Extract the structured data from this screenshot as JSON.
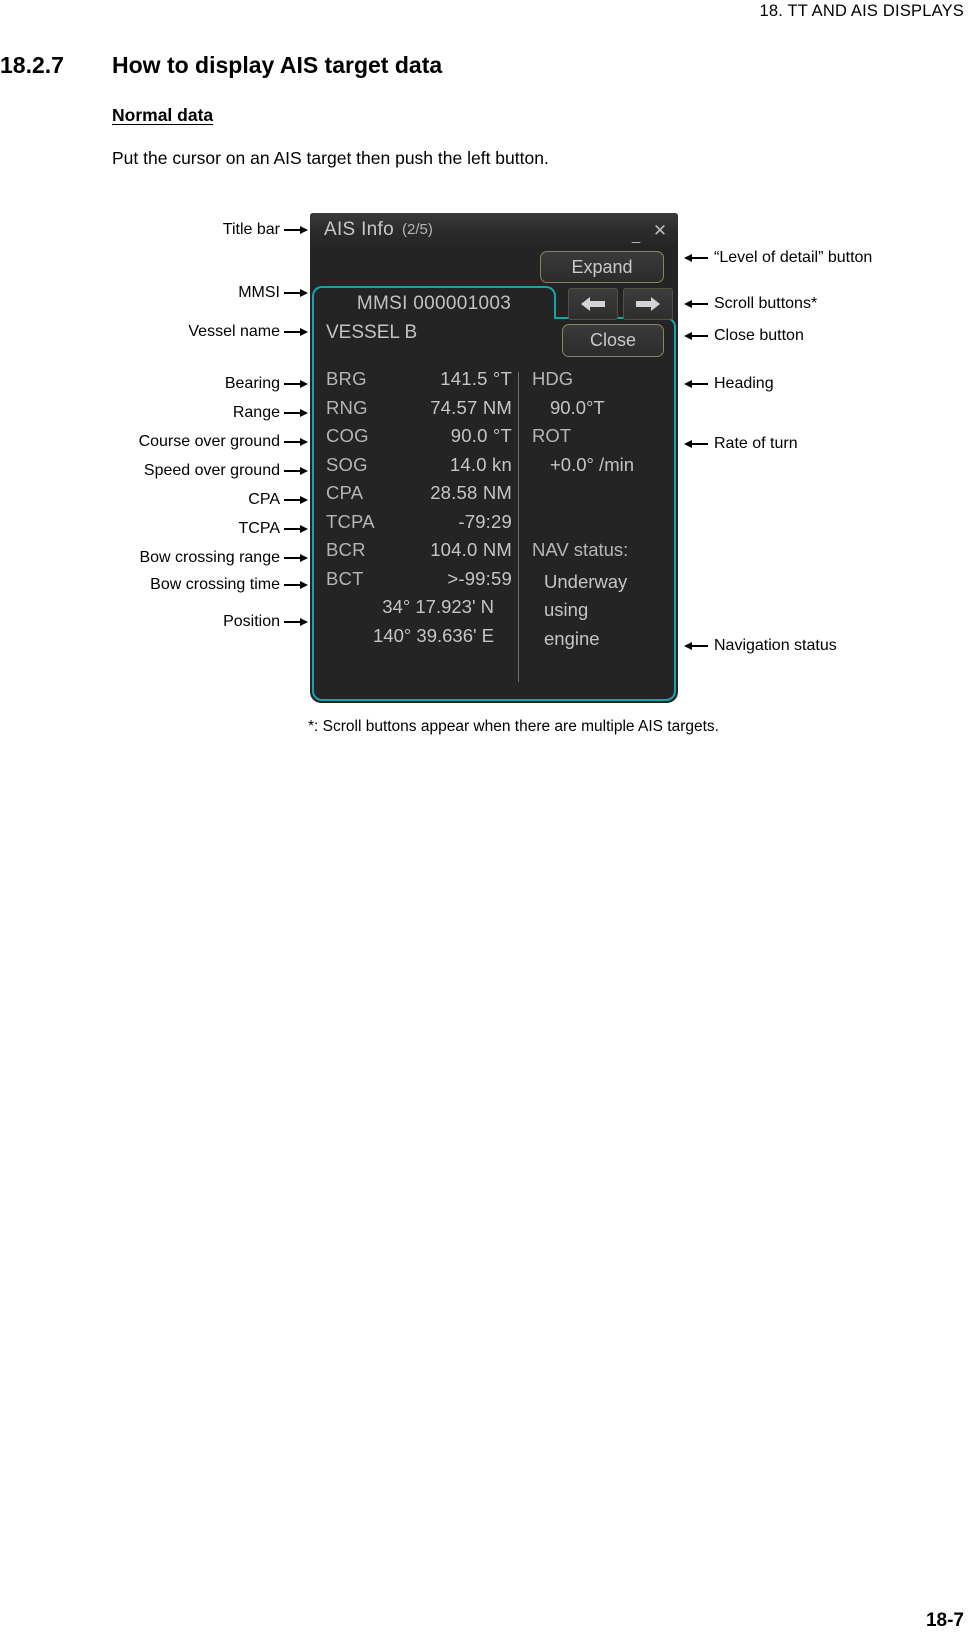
{
  "page": {
    "header": "18.  TT AND AIS DISPLAYS",
    "section_number": "18.2.7",
    "section_title": "How to display AIS target data",
    "subheading": "Normal data",
    "intro": "Put the cursor on an AIS target then push the left button.",
    "footnote": "*: Scroll buttons appear when there are multiple AIS targets.",
    "page_number": "18-7"
  },
  "panel": {
    "title": "AIS Info",
    "page_count": "(2/5)",
    "minimize_icon": "_",
    "close_icon": "✕",
    "expand_label": "Expand",
    "close_label": "Close",
    "mmsi_label": "MMSI 000001003",
    "vessel_name": "VESSEL B",
    "scroll_prev_icon": "arrow-left-icon",
    "scroll_next_icon": "arrow-right-icon",
    "left_rows": [
      {
        "key": "BRG",
        "value": "141.5 °T"
      },
      {
        "key": "RNG",
        "value": "74.57 NM"
      },
      {
        "key": "COG",
        "value": "90.0 °T"
      },
      {
        "key": "SOG",
        "value": "14.0 kn"
      },
      {
        "key": "CPA",
        "value": "28.58 NM"
      },
      {
        "key": "TCPA",
        "value": "-79:29"
      },
      {
        "key": "BCR",
        "value": "104.0 NM"
      },
      {
        "key": "BCT",
        "value": ">-99:59"
      }
    ],
    "position": {
      "latitude": "34° 17.923'  N",
      "longitude": "140° 39.636'  E"
    },
    "right_rows": [
      {
        "key": "HDG",
        "value": "90.0°T"
      },
      {
        "key": "ROT",
        "value": "+0.0° /min"
      }
    ],
    "nav_status_label": "NAV status:",
    "nav_status_lines": [
      "Underway",
      "using",
      "engine"
    ],
    "accent_border": "#19a3a8",
    "panel_bg": "#242424",
    "text_color": "#c2c2c2"
  },
  "callouts": {
    "left": [
      "Title bar",
      "MMSI",
      "Vessel name",
      "Bearing",
      "Range",
      "Course over ground",
      "Speed over ground",
      "CPA",
      "TCPA",
      "Bow crossing range",
      "Bow crossing time",
      "Position"
    ],
    "right": [
      "“Level of detail” button",
      "Scroll buttons*",
      "Close button",
      "Heading",
      "Rate of turn",
      "Navigation status"
    ]
  }
}
